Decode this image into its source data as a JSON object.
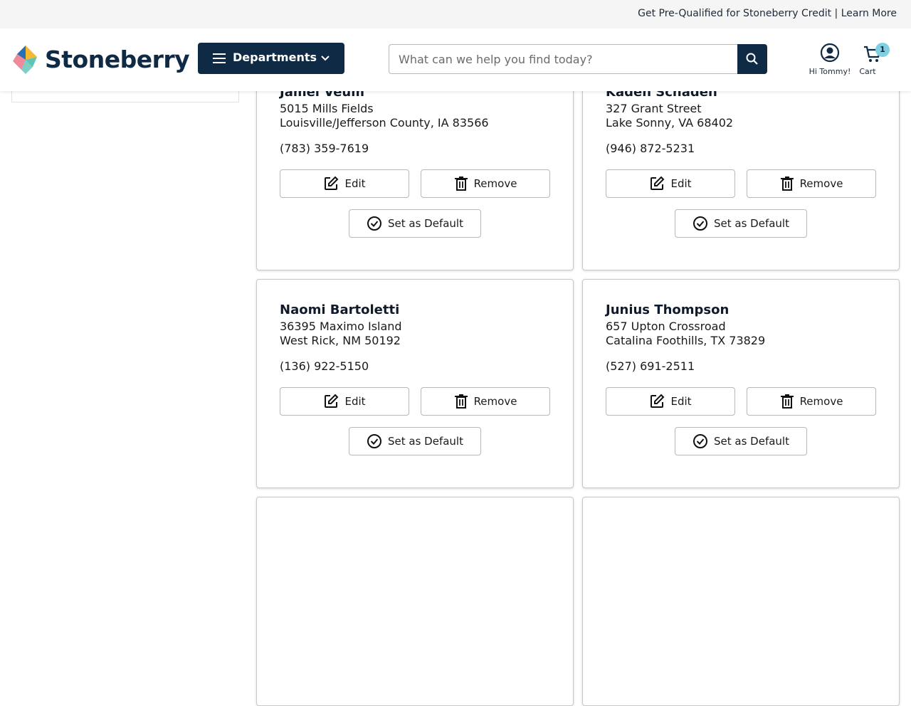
{
  "promo": {
    "text": "Get Pre-Qualified for Stoneberry Credit | Learn More"
  },
  "header": {
    "logo_text": "Stoneberry",
    "departments_label": "Departments",
    "search_placeholder": "What can we help you find today?",
    "account_label": "Hi Tommy!",
    "cart_label": "Cart",
    "cart_count": "1"
  },
  "addresses": [
    {
      "name": "Jamel Veum",
      "street": "5015 Mills Fields",
      "city": "Louisville/Jefferson County, IA 83566",
      "phone": "(783) 359-7619"
    },
    {
      "name": "Kaden Schaden",
      "street": "327 Grant Street",
      "city": "Lake Sonny, VA 68402",
      "phone": "(946) 872-5231"
    },
    {
      "name": "Naomi Bartoletti",
      "street": "36395 Maximo Island",
      "city": "West Rick, NM 50192",
      "phone": "(136) 922-5150"
    },
    {
      "name": "Junius Thompson",
      "street": "657 Upton Crossroad",
      "city": "Catalina Foothills, TX 73829",
      "phone": "(527) 691-2511"
    }
  ],
  "buttons": {
    "edit": "Edit",
    "remove": "Remove",
    "set_default": "Set as Default"
  },
  "colors": {
    "brand_navy": "#0f2a44",
    "badge": "#7fd0e0",
    "promo_bg": "#f5f5f5"
  },
  "icons": [
    "hamburger-icon",
    "chevron-down-icon",
    "search-icon",
    "account-icon",
    "cart-icon",
    "edit-icon",
    "trash-icon",
    "check-circle-icon"
  ]
}
